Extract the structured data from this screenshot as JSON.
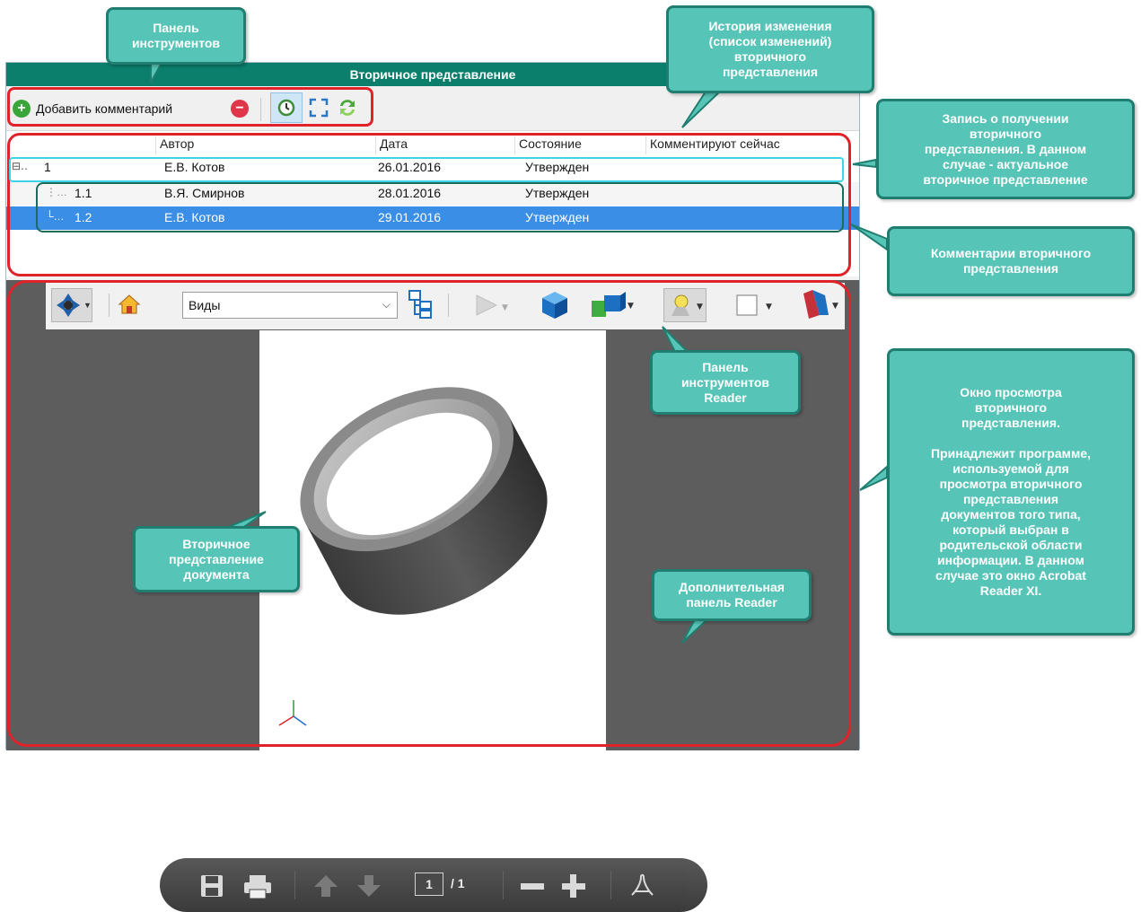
{
  "window": {
    "title": "Вторичное представление"
  },
  "toolbar": {
    "add_comment_label": "Добавить комментарий"
  },
  "grid": {
    "columns": [
      "Автор",
      "Дата",
      "Состояние",
      "Комментируют сейчас"
    ],
    "rows": [
      {
        "num": "1",
        "author": "Е.В. Котов",
        "date": "26.01.2016",
        "state": "Утвержден"
      },
      {
        "num": "1.1",
        "author": "В.Я. Смирнов",
        "date": "28.01.2016",
        "state": "Утвержден"
      },
      {
        "num": "1.2",
        "author": "Е.В. Котов",
        "date": "29.01.2016",
        "state": "Утвержден"
      }
    ]
  },
  "reader": {
    "views_select_value": "Виды",
    "page_current": "1",
    "page_total": "/ 1"
  },
  "callouts": {
    "toolbar_panel": "Панель\nинструментов",
    "history": "История изменения\n(список изменений)\nвторичного\nпредставления",
    "record": "Запись о получении\nвторичного\nпредставления. В данном\nслучае - актуальное\nвторичное представление",
    "comments": "Комментарии вторичного\nпредставления",
    "reader_toolbar": "Панель\nинструментов\nReader",
    "view_window": "Окно просмотра\nвторичного\nпредставления.\n\nПринадлежит программе,\nиспользуемой для\nпросмотра вторичного\nпредставления\nдокументов того типа,\nкоторый выбран в\nродительской области\nинформации. В данном\nслучае это окно Acrobat\nReader XI.",
    "doc_view": "Вторичное\nпредставление\nдокумента",
    "extra_panel": "Дополнительная\nпанель Reader"
  },
  "colors": {
    "title_bar": "#0b7e6c",
    "callout_fill": "#56c4b7",
    "callout_border": "#1f7e6f",
    "highlight_red": "#e0222a",
    "highlight_cyan": "#3fd3e8",
    "highlight_teal": "#1d6b5d",
    "selection": "#3a8ee6"
  },
  "icons": [
    "add-icon",
    "remove-icon",
    "history-icon",
    "fullscreen-icon",
    "refresh-icon",
    "navigate-icon",
    "home-icon",
    "model-tree-icon",
    "play-icon",
    "cube-icon",
    "parts-icon",
    "lighting-icon",
    "background-color-icon",
    "render-mode-icon",
    "save-icon",
    "print-icon",
    "prev-page-icon",
    "next-page-icon",
    "zoom-out-icon",
    "zoom-in-icon",
    "acrobat-icon",
    "axes-icon"
  ]
}
